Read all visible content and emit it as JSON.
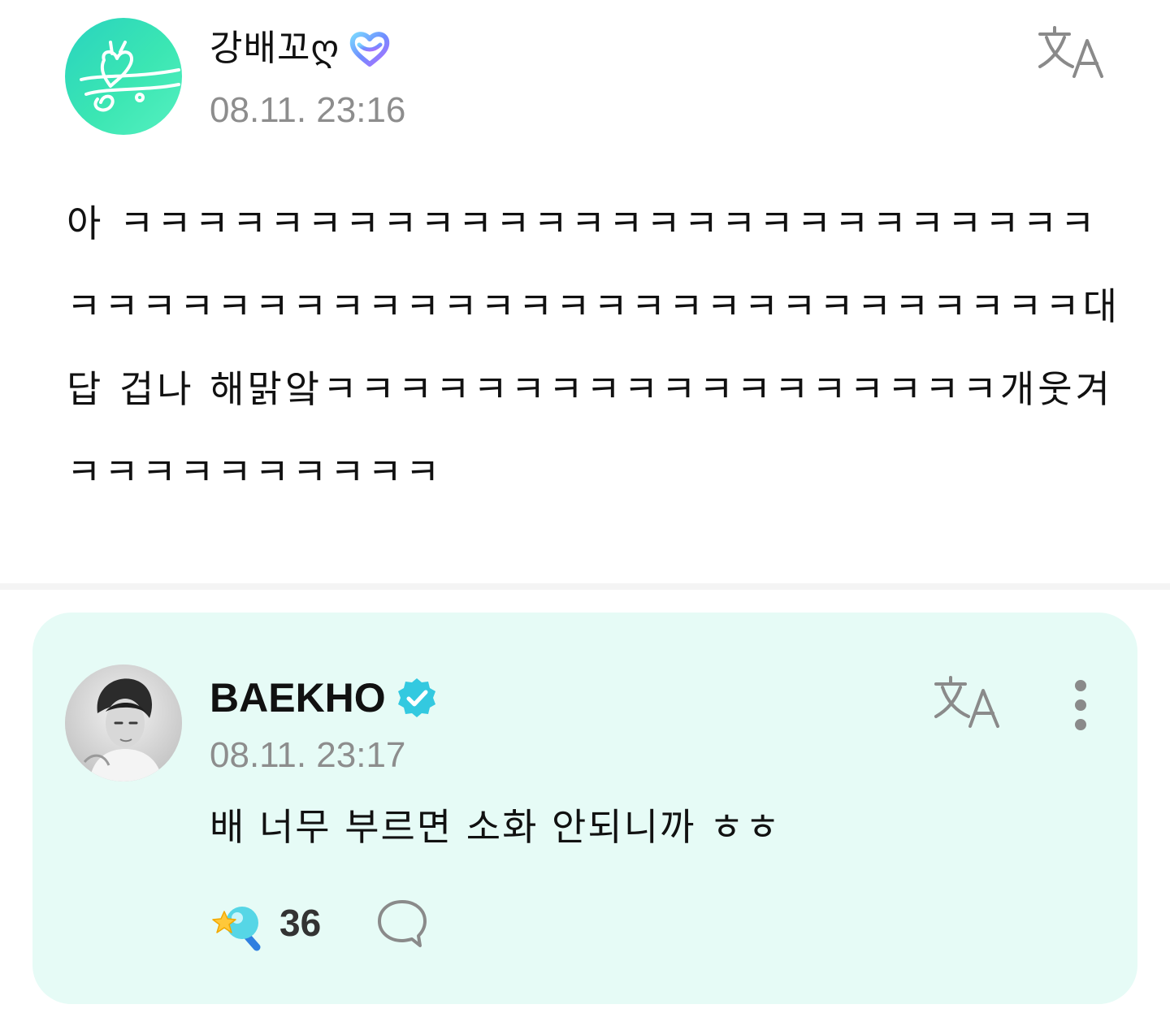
{
  "post": {
    "author": "강배꼬ღ",
    "badge_icon": "weverse-membership-heart-icon",
    "timestamp": "08.11. 23:16",
    "translate_icon": "translate-icon",
    "body": "아 ㅋㅋㅋㅋㅋㅋㅋㅋㅋㅋㅋㅋㅋㅋㅋㅋㅋㅋㅋㅋㅋㅋㅋㅋㅋㅋㅋㅋㅋㅋㅋㅋㅋㅋㅋㅋㅋㅋㅋㅋㅋㅋㅋㅋㅋㅋㅋㅋㅋㅋㅋㅋㅋ대답 겁나 해맑앜ㅋㅋㅋㅋㅋㅋㅋㅋㅋㅋㅋㅋㅋㅋㅋㅋㅋㅋ개웃겨ㅋㅋㅋㅋㅋㅋㅋㅋㅋㅋ"
  },
  "reply": {
    "author": "BAEKHO",
    "verified_icon": "verified-badge-icon",
    "timestamp": "08.11. 23:17",
    "translate_icon": "translate-icon",
    "more_icon": "more-vertical-icon",
    "body": "배 너무 부르면 소화 안되니까 ㅎㅎ",
    "like_icon": "star-lightstick-icon",
    "like_count": "36",
    "comment_icon": "comment-bubble-icon"
  },
  "colors": {
    "card_background": "#e6fbf6",
    "timestamp_gray": "#8d8d8d",
    "avatar_mint": "#3be6b3",
    "verified_teal": "#33c9e0"
  }
}
